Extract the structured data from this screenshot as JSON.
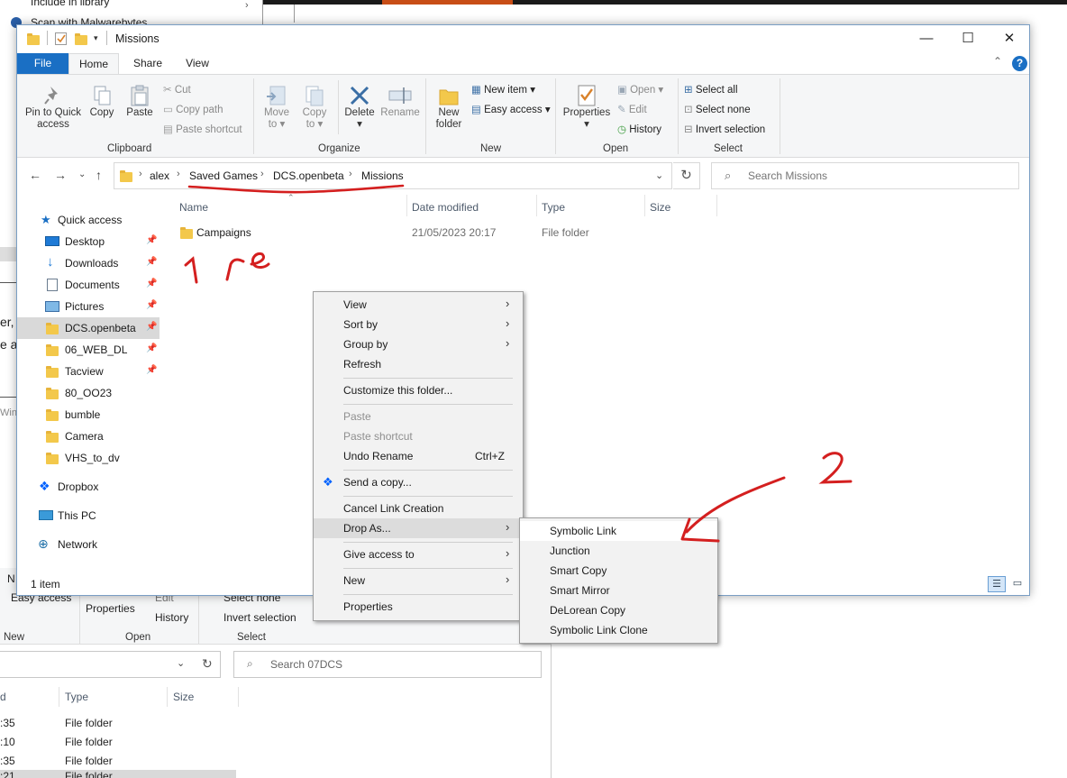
{
  "background": {
    "top_menu_lines": [
      "Include in library",
      "Scan with Malwarebytes"
    ],
    "fragments": [
      "er,",
      "e a",
      "Wind"
    ],
    "ribbon_items": [
      "N",
      "Easy access",
      "Properties",
      "Edit",
      "History",
      "Select none",
      "Invert selection"
    ],
    "group_labels": [
      "New",
      "Open",
      "Select"
    ],
    "search_placeholder": "Search 07DCS",
    "columns": [
      "d",
      "Type",
      "Size"
    ],
    "rows": [
      {
        "time": ":35",
        "type": "File folder"
      },
      {
        "time": ":10",
        "type": "File folder"
      },
      {
        "time": ":35",
        "type": "File folder"
      },
      {
        "time": ":21",
        "type": "File folder"
      }
    ]
  },
  "window": {
    "title": "Missions",
    "controls": {
      "minimize": "—",
      "maximize": "☐",
      "close": "✕"
    },
    "tabs": {
      "file": "File",
      "home": "Home",
      "share": "Share",
      "view": "View"
    },
    "help": "?",
    "collapse": "⌃"
  },
  "ribbon": {
    "clipboard": {
      "label": "Clipboard",
      "pin": "Pin to Quick access",
      "pin_l1": "Pin to Quick",
      "pin_l2": "access",
      "copy": "Copy",
      "paste": "Paste",
      "cut": "Cut",
      "copy_path": "Copy path",
      "paste_shortcut": "Paste shortcut"
    },
    "organize": {
      "label": "Organize",
      "move_l1": "Move",
      "move_l2": "to",
      "copy_l1": "Copy",
      "copy_l2": "to",
      "delete": "Delete",
      "rename": "Rename"
    },
    "new": {
      "label": "New",
      "folder_l1": "New",
      "folder_l2": "folder",
      "new_item": "New item",
      "easy_access": "Easy access"
    },
    "open": {
      "label": "Open",
      "properties": "Properties",
      "open": "Open",
      "edit": "Edit",
      "history": "History"
    },
    "select": {
      "label": "Select",
      "all": "Select all",
      "none": "Select none",
      "invert": "Invert selection"
    }
  },
  "navigation": {
    "breadcrumb": [
      "alex",
      "Saved Games",
      "DCS.openbeta",
      "Missions"
    ],
    "search_placeholder": "Search Missions"
  },
  "nav_pane": {
    "items": [
      {
        "label": "Quick access",
        "pinned": false,
        "icon": "star-icon"
      },
      {
        "label": "Desktop",
        "pinned": true,
        "icon": "desktop-icon"
      },
      {
        "label": "Downloads",
        "pinned": true,
        "icon": "download-icon"
      },
      {
        "label": "Documents",
        "pinned": true,
        "icon": "document-icon"
      },
      {
        "label": "Pictures",
        "pinned": true,
        "icon": "pictures-icon"
      },
      {
        "label": "DCS.openbeta",
        "pinned": true,
        "icon": "folder-icon",
        "selected": true
      },
      {
        "label": "06_WEB_DL",
        "pinned": true,
        "icon": "folder-icon"
      },
      {
        "label": "Tacview",
        "pinned": true,
        "icon": "folder-icon"
      },
      {
        "label": "80_OO23",
        "pinned": false,
        "icon": "folder-icon"
      },
      {
        "label": "bumble",
        "pinned": false,
        "icon": "folder-icon"
      },
      {
        "label": "Camera",
        "pinned": false,
        "icon": "folder-icon"
      },
      {
        "label": "VHS_to_dv",
        "pinned": false,
        "icon": "folder-icon"
      },
      {
        "label": "Dropbox",
        "pinned": false,
        "icon": "dropbox-icon"
      },
      {
        "label": "This PC",
        "pinned": false,
        "icon": "computer-icon"
      },
      {
        "label": "Network",
        "pinned": false,
        "icon": "network-icon"
      }
    ]
  },
  "file_list": {
    "columns": {
      "name": "Name",
      "date": "Date modified",
      "type": "Type",
      "size": "Size"
    },
    "rows": [
      {
        "name": "Campaigns",
        "date": "21/05/2023 20:17",
        "type": "File folder",
        "size": ""
      }
    ]
  },
  "status": {
    "count": "1 item"
  },
  "context_menu": {
    "items": [
      {
        "label": "View",
        "submenu": true
      },
      {
        "label": "Sort by",
        "submenu": true
      },
      {
        "label": "Group by",
        "submenu": true
      },
      {
        "label": "Refresh"
      },
      {
        "label": "Customize this folder..."
      },
      {
        "label": "Paste",
        "disabled": true
      },
      {
        "label": "Paste shortcut",
        "disabled": true
      },
      {
        "label": "Undo Rename",
        "shortcut": "Ctrl+Z"
      },
      {
        "label": "Send a copy..."
      },
      {
        "label": "Cancel Link Creation"
      },
      {
        "label": "Drop As...",
        "submenu": true
      },
      {
        "label": "Give access to",
        "submenu": true
      },
      {
        "label": "New",
        "submenu": true
      },
      {
        "label": "Properties"
      }
    ]
  },
  "submenu": {
    "items": [
      "Symbolic Link",
      "Junction",
      "Smart Copy",
      "Smart Mirror",
      "DeLorean Copy",
      "Symbolic Link Clone"
    ]
  },
  "annotation_color": "#d41f1f"
}
